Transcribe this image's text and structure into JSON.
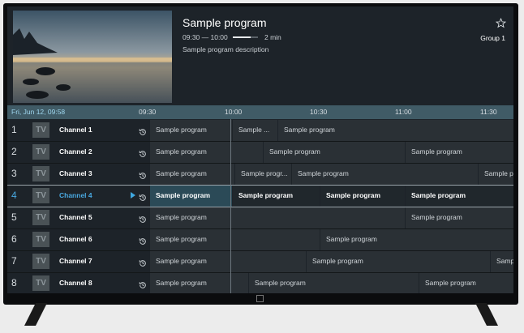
{
  "program": {
    "title": "Sample program",
    "time": "09:30 — 10:00",
    "progress": 0.7,
    "duration": "2 min",
    "description": "Sample program description",
    "group": "Group 1"
  },
  "timeline": {
    "date": "Fri, Jun 12, 09:58",
    "ticks": [
      "09:30",
      "10:00",
      "10:30",
      "11:00",
      "11:30"
    ]
  },
  "channels": [
    {
      "num": "1",
      "name": "Channel 1",
      "logo": "TV",
      "programs": [
        "Sample program",
        "Sample ...",
        "Sample program"
      ]
    },
    {
      "num": "2",
      "name": "Channel 2",
      "logo": "TV",
      "programs": [
        "Sample program",
        "Sample program",
        "Sample program"
      ]
    },
    {
      "num": "3",
      "name": "Channel 3",
      "logo": "TV",
      "programs": [
        "Sample program",
        "Sample progr...",
        "Sample program",
        "Sample pr"
      ]
    },
    {
      "num": "4",
      "name": "Channel 4",
      "logo": "TV",
      "programs": [
        "Sample program",
        "Sample program",
        "Sample program",
        "Sample program"
      ]
    },
    {
      "num": "5",
      "name": "Channel 5",
      "logo": "TV",
      "programs": [
        "Sample program",
        "Sample program"
      ]
    },
    {
      "num": "6",
      "name": "Channel 6",
      "logo": "TV",
      "programs": [
        "Sample program",
        "Sample program"
      ]
    },
    {
      "num": "7",
      "name": "Channel 7",
      "logo": "TV",
      "programs": [
        "Sample program",
        "Sample program",
        "Samp"
      ]
    },
    {
      "num": "8",
      "name": "Channel 8",
      "logo": "TV",
      "programs": [
        "Sample program",
        "Sample program",
        "Sample program"
      ]
    }
  ],
  "colors": {
    "accent": "#49a8e0",
    "timebar": "#405b66",
    "background": "#1d2329"
  }
}
